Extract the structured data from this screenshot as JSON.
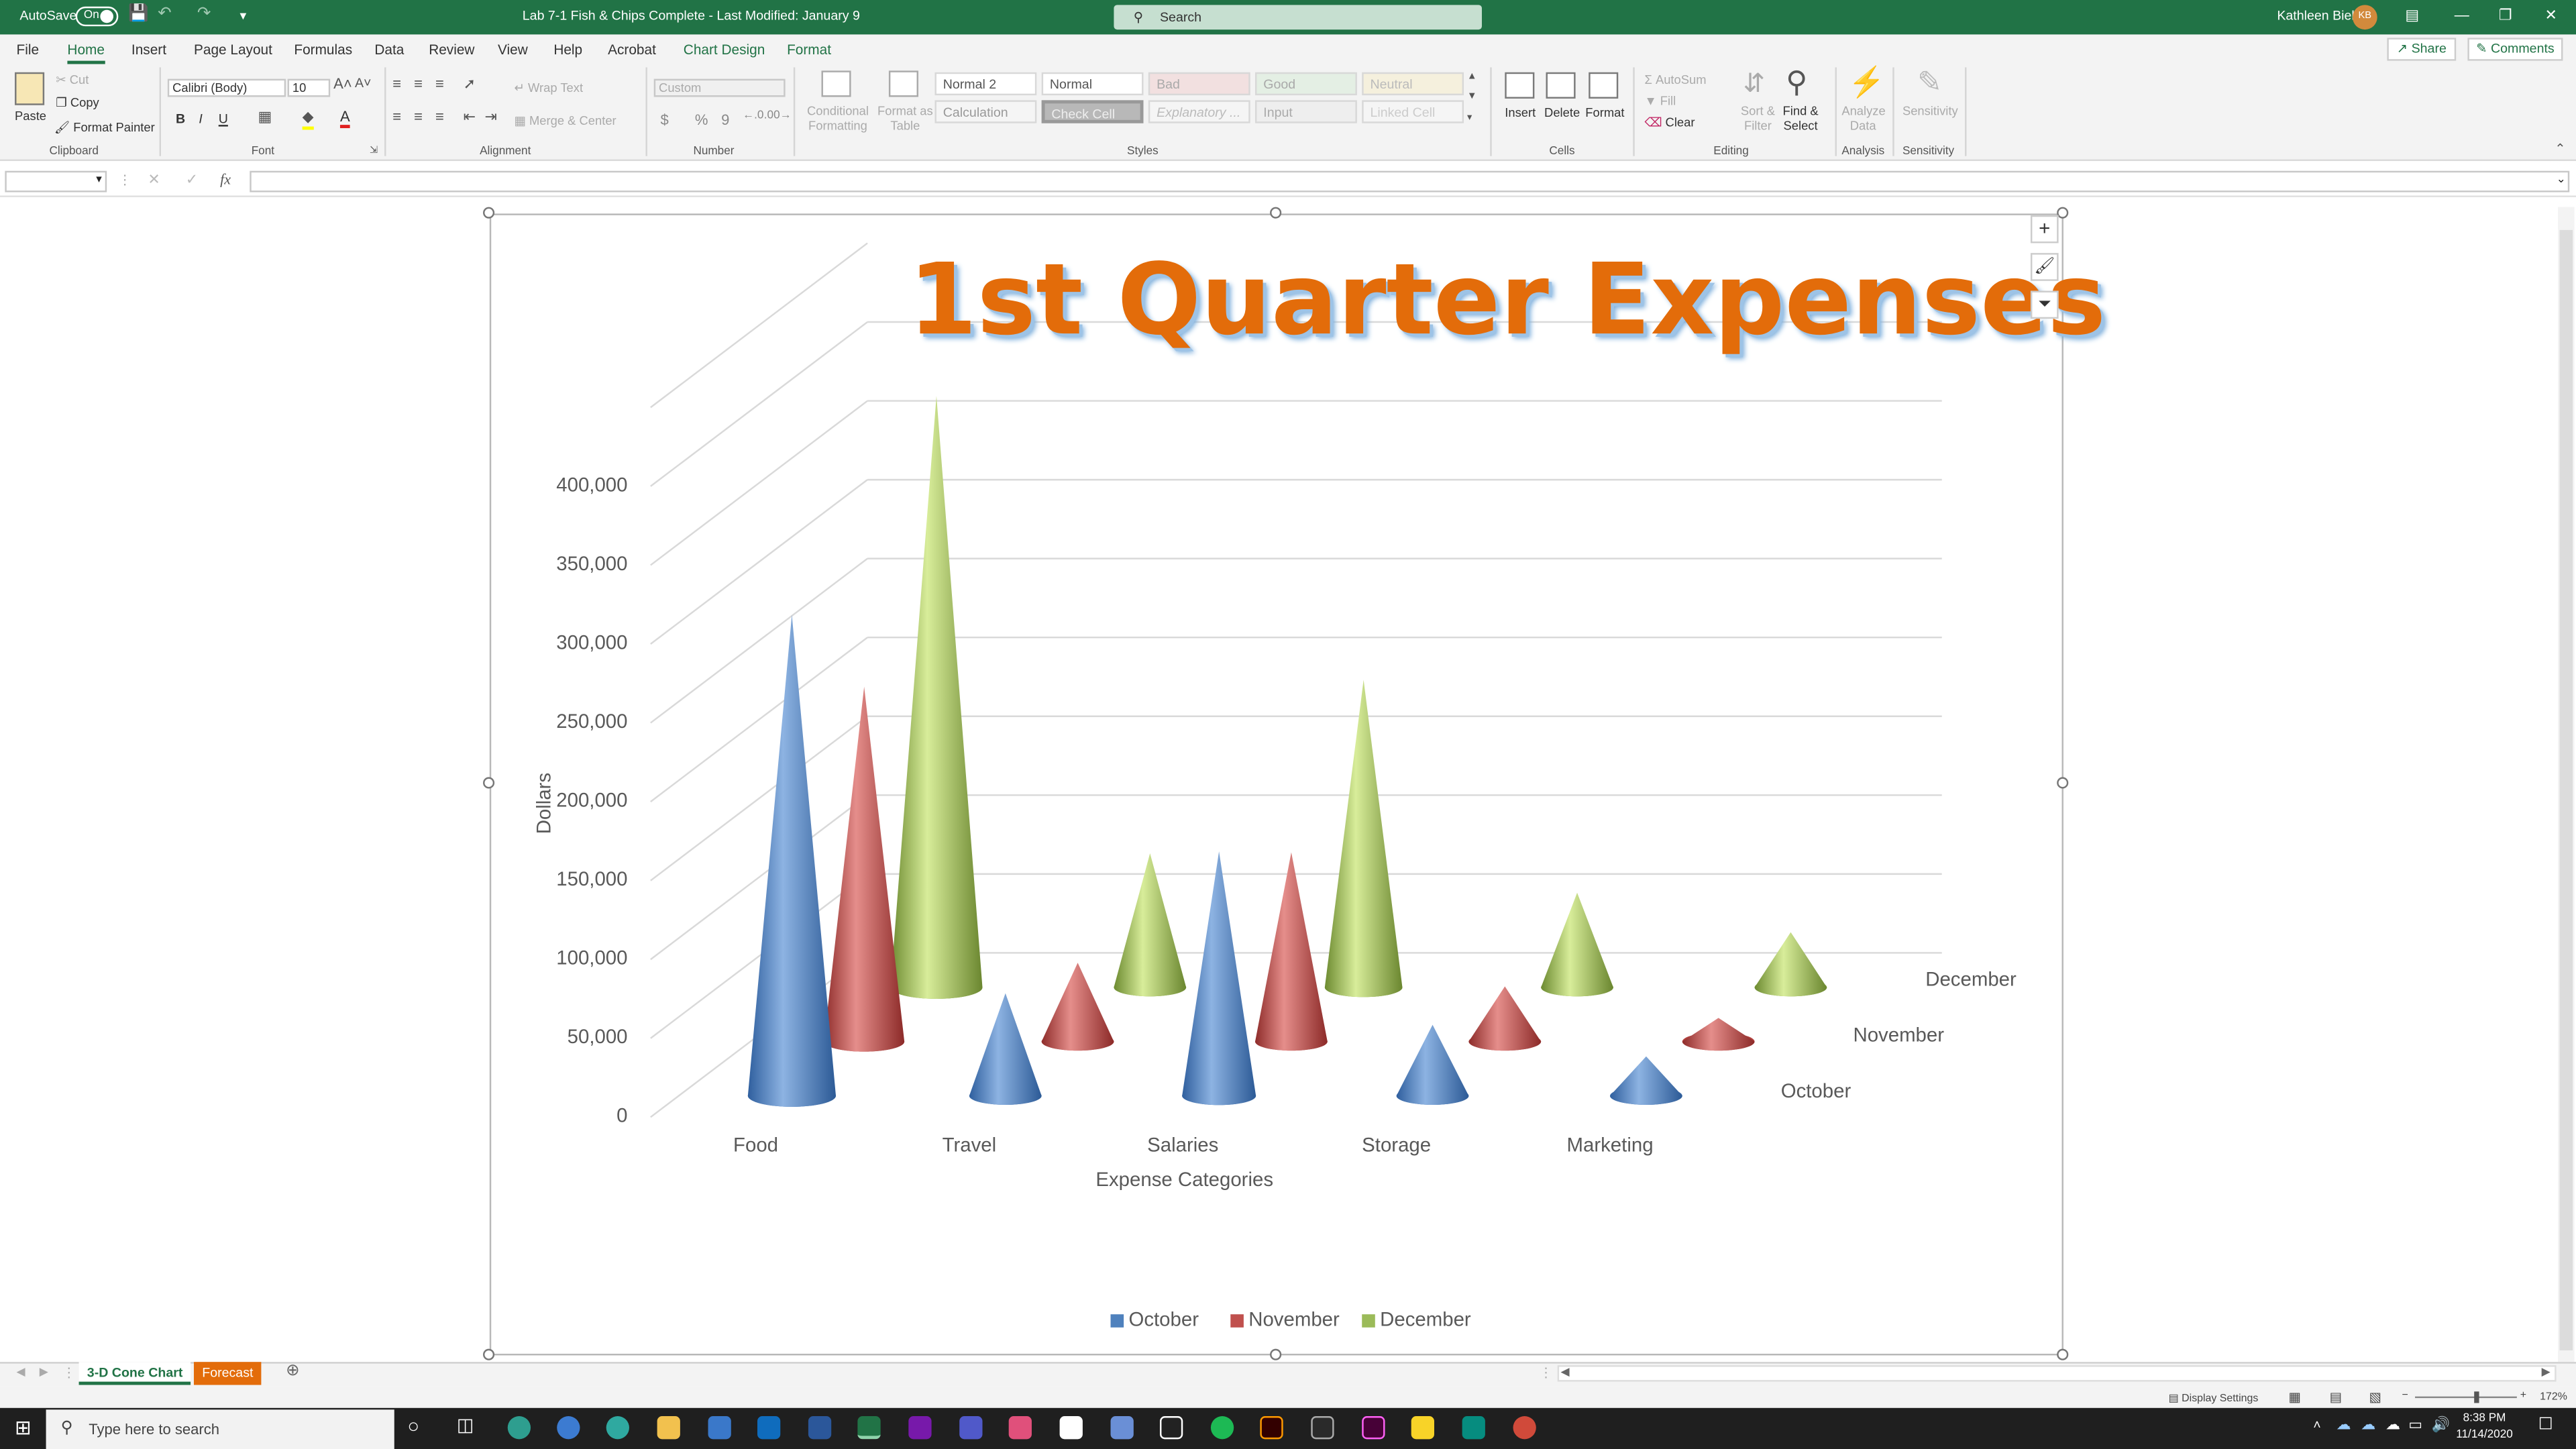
{
  "titlebar": {
    "autosave_label": "AutoSave",
    "autosave_state": "On",
    "document_title": "Lab 7-1 Fish & Chips Complete  -  Last Modified: January 9",
    "search_placeholder": "Search",
    "user_name": "Kathleen Biel",
    "user_initials": "KB",
    "bg_color": "#217346"
  },
  "tabs": [
    "File",
    "Home",
    "Insert",
    "Page Layout",
    "Formulas",
    "Data",
    "Review",
    "View",
    "Help",
    "Acrobat",
    "Chart Design",
    "Format"
  ],
  "actions": {
    "share": "Share",
    "comments": "Comments"
  },
  "ribbon": {
    "clipboard": {
      "paste": "Paste",
      "cut": "Cut",
      "copy": "Copy",
      "format_painter": "Format Painter",
      "group": "Clipboard"
    },
    "font": {
      "name": "Calibri (Body)",
      "size": "10",
      "group": "Font",
      "bold": "B",
      "italic": "I",
      "underline": "U"
    },
    "alignment": {
      "wrap": "Wrap Text",
      "merge": "Merge & Center",
      "group": "Alignment"
    },
    "number": {
      "format": "Custom",
      "group": "Number",
      "currency": "$",
      "percent": "%",
      "comma": "9"
    },
    "styles": {
      "conditional": "Conditional Formatting",
      "format_table": "Format as Table",
      "cells": [
        "Normal 2",
        "Normal",
        "Bad",
        "Good",
        "Neutral",
        "Calculation",
        "Check Cell",
        "Explanatory ...",
        "Input",
        "Linked Cell"
      ],
      "group": "Styles"
    },
    "cells": {
      "insert": "Insert",
      "delete": "Delete",
      "format": "Format",
      "group": "Cells"
    },
    "editing": {
      "autosum": "AutoSum",
      "fill": "Fill",
      "clear": "Clear",
      "sort": "Sort & Filter",
      "find": "Find & Select",
      "group": "Editing"
    },
    "analysis": {
      "analyze": "Analyze Data",
      "group": "Analysis"
    },
    "sensitivity": {
      "label": "Sensitivity",
      "group": "Sensitivity"
    }
  },
  "formula_bar": {
    "fx": "fx",
    "name_box": "",
    "value": ""
  },
  "chart_data": {
    "type": "3d-cone",
    "title": "1st Quarter Expenses",
    "xlabel": "Expense Categories",
    "ylabel": "Dollars",
    "categories": [
      "Food",
      "Travel",
      "Salaries",
      "Storage",
      "Marketing"
    ],
    "depth_labels": [
      "October",
      "November",
      "December"
    ],
    "y_ticks": [
      "0",
      "50,000",
      "100,000",
      "150,000",
      "200,000",
      "250,000",
      "300,000",
      "350,000",
      "400,000"
    ],
    "ylim": [
      0,
      400000
    ],
    "grid": true,
    "legend_position": "bottom",
    "series": [
      {
        "name": "October",
        "color": "#4f81bd",
        "values": [
          305000,
          65000,
          155000,
          45000,
          25000
        ]
      },
      {
        "name": "November",
        "color": "#c0504d",
        "values": [
          225000,
          50000,
          120000,
          35000,
          15000
        ]
      },
      {
        "name": "December",
        "color": "#9bbb59",
        "values": [
          375000,
          85000,
          195000,
          60000,
          35000
        ]
      }
    ]
  },
  "sheets": [
    {
      "name": "3-D Cone Chart",
      "active": true
    },
    {
      "name": "Forecast",
      "active": false,
      "color": "#e36c0a"
    }
  ],
  "status": {
    "display_settings": "Display Settings",
    "zoom": "172%"
  },
  "taskbar": {
    "search_placeholder": "Type here to search",
    "time": "8:38 PM",
    "date": "11/14/2020"
  }
}
